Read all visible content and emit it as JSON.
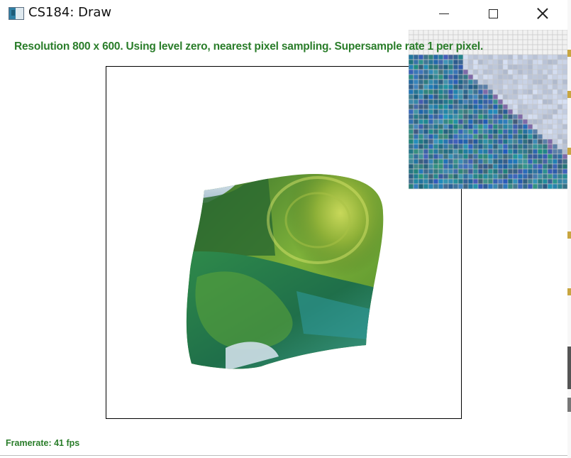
{
  "window": {
    "title": "CS184: Draw"
  },
  "colors": {
    "hud_text": "#2a7d2a",
    "frame_border": "#000000",
    "background": "#ffffff"
  },
  "hud": {
    "status_line": "Resolution 800 x 600. Using level zero, nearest pixel sampling. Supersample rate 1 per pixel.",
    "framerate": "Framerate: 41 fps"
  },
  "icons": {
    "app": "app-window-icon",
    "minimize": "minimize-icon",
    "maximize": "maximize-icon",
    "close": "close-icon"
  }
}
